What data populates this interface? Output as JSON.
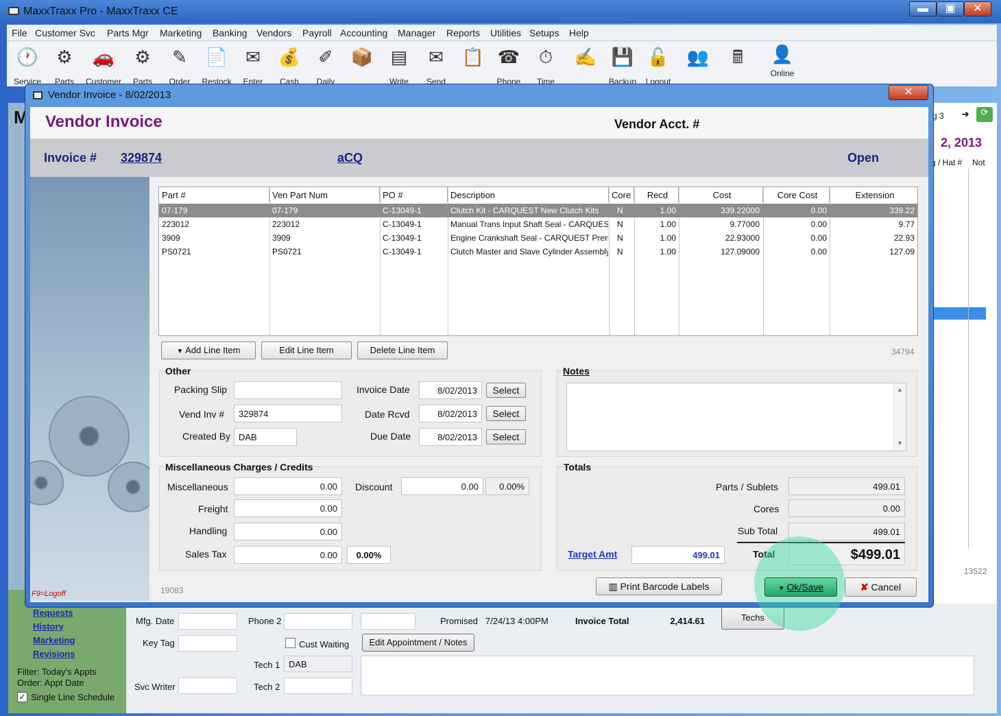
{
  "app": {
    "title": "MaxxTraxx Pro - MaxxTraxx CE",
    "minimize": "▬",
    "maximize": "▣",
    "close": "✕"
  },
  "menu": [
    "File",
    "Customer Svc",
    "Parts Mgr",
    "Marketing",
    "Banking",
    "Vendors",
    "Payroll",
    "Accounting",
    "Manager",
    "Reports",
    "Utilities",
    "Setups",
    "Help"
  ],
  "toolbar": [
    {
      "label": "Service",
      "icon": "🕐"
    },
    {
      "label": "Parts",
      "icon": "⚙"
    },
    {
      "label": "Customer",
      "icon": "🚗"
    },
    {
      "label": "Parts",
      "icon": "⚙"
    },
    {
      "label": "Order",
      "icon": "✎"
    },
    {
      "label": "Restock",
      "icon": "📄"
    },
    {
      "label": "Enter",
      "icon": "✉"
    },
    {
      "label": "Cash",
      "icon": "💰"
    },
    {
      "label": "Daily",
      "icon": "✐"
    },
    {
      "label": "",
      "icon": "📦"
    },
    {
      "label": "Write",
      "icon": "▤"
    },
    {
      "label": "Send",
      "icon": "✉"
    },
    {
      "label": "",
      "icon": "📋"
    },
    {
      "label": "Phone",
      "icon": "☎"
    },
    {
      "label": "Time",
      "icon": "⏱"
    },
    {
      "label": "",
      "icon": "✍"
    },
    {
      "label": "Backup",
      "icon": "💾"
    },
    {
      "label": "Logout",
      "icon": "🔓"
    },
    {
      "label": "",
      "icon": "👥"
    },
    {
      "label": "",
      "icon": "🖩"
    },
    {
      "label": "Online",
      "icon": "👤"
    }
  ],
  "background": {
    "m_letter": "M",
    "date_partial": "2, 2013",
    "tab_partial": "g 3",
    "grid_headers": [
      "g / Hat #",
      "Not"
    ],
    "counter": "13522",
    "nav_links": [
      "Requests",
      "History",
      "Marketing",
      "Revisions"
    ],
    "filter": "Filter: Today's Appts",
    "order": "Order: Appt Date",
    "single_line": "Single Line Schedule",
    "form": {
      "mfg_date_label": "Mfg. Date",
      "phone2_label": "Phone 2",
      "promised_label": "Promised",
      "promised_value": "7/24/13  4:00PM",
      "invoice_total_label": "Invoice Total",
      "invoice_total_value": "2,414.61",
      "techs_button": "Techs",
      "key_tag_label": "Key Tag",
      "cust_waiting_label": "Cust Waiting",
      "edit_appt_button": "Edit Appointment / Notes",
      "tech1_label": "Tech 1",
      "tech1_value": "DAB",
      "tech2_label": "Tech 2",
      "svc_writer_label": "Svc Writer"
    }
  },
  "dialog": {
    "title": "Vendor Invoice -  8/02/2013",
    "close": "✕",
    "heading": "Vendor Invoice",
    "vendor_acct_label": "Vendor Acct. #",
    "invoice_label": "Invoice #",
    "invoice_number": "329874",
    "vendor_code": "aCQ",
    "status": "Open",
    "f9_hint": "F9=Logoff",
    "table": {
      "columns": [
        "Part #",
        "Ven Part Num",
        "PO #",
        "Description",
        "Core",
        "Recd",
        "Cost",
        "Core Cost",
        "Extension"
      ],
      "rows": [
        [
          "07-179",
          "07-179",
          "C-13049-1",
          "Clutch Kit - CARQUEST New Clutch Kits",
          "N",
          "1.00",
          "339.22000",
          "0.00",
          "339.22"
        ],
        [
          "223012",
          "223012",
          "C-13049-1",
          "Manual Trans Input Shaft Seal - CARQUEST",
          "N",
          "1.00",
          "9.77000",
          "0.00",
          "9.77"
        ],
        [
          "3909",
          "3909",
          "C-13049-1",
          "Engine Crankshaft Seal - CARQUEST Premium",
          "N",
          "1.00",
          "22.93000",
          "0.00",
          "22.93"
        ],
        [
          "PS0721",
          "PS0721",
          "C-13049-1",
          "Clutch Master and Slave Cylinder Assembly",
          "N",
          "1.00",
          "127.09000",
          "0.00",
          "127.09"
        ]
      ]
    },
    "buttons": {
      "add_line": "Add Line Item",
      "edit_line": "Edit Line Item",
      "delete_line": "Delete Line Item",
      "select": "Select",
      "print_barcode": "Print Barcode Labels",
      "ok_save": "Ok/Save",
      "cancel": "Cancel"
    },
    "record_id": "34794",
    "record_id2": "19083",
    "other": {
      "title": "Other",
      "packing_slip_label": "Packing Slip",
      "packing_slip_value": "",
      "vend_inv_label": "Vend Inv #",
      "vend_inv_value": "329874",
      "created_by_label": "Created By",
      "created_by_value": "DAB",
      "invoice_date_label": "Invoice Date",
      "invoice_date_value": "8/02/2013",
      "date_rcvd_label": "Date Rcvd",
      "date_rcvd_value": "8/02/2013",
      "due_date_label": "Due Date",
      "due_date_value": "8/02/2013"
    },
    "notes": {
      "title": "Notes",
      "value": ""
    },
    "misc": {
      "title": "Miscellaneous Charges / Credits",
      "misc_label": "Miscellaneous",
      "misc_value": "0.00",
      "freight_label": "Freight",
      "freight_value": "0.00",
      "handling_label": "Handling",
      "handling_value": "0.00",
      "sales_tax_label": "Sales Tax",
      "sales_tax_value": "0.00",
      "sales_tax_pct": "0.00%",
      "discount_label": "Discount",
      "discount_value": "0.00",
      "discount_pct": "0.00%"
    },
    "totals": {
      "title": "Totals",
      "parts_label": "Parts / Sublets",
      "parts_value": "499.01",
      "cores_label": "Cores",
      "cores_value": "0.00",
      "subtotal_label": "Sub Total",
      "subtotal_value": "499.01",
      "target_label": "Target Amt",
      "target_value": "499.01",
      "total_label": "Total",
      "total_value": "$499.01"
    }
  }
}
